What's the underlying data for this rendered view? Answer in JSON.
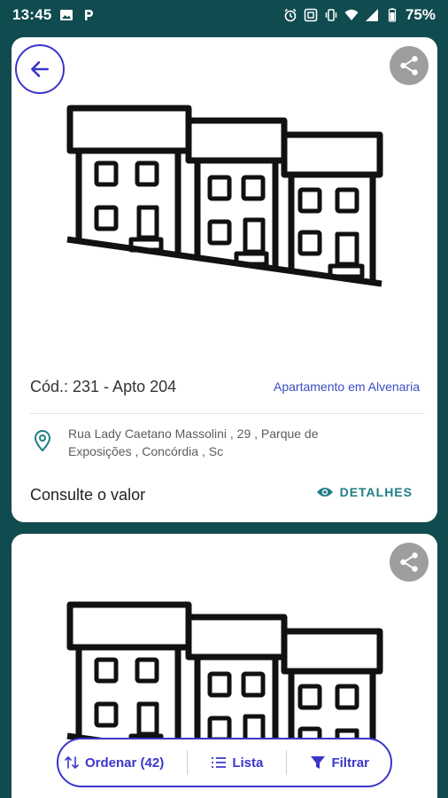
{
  "status_bar": {
    "time": "13:45",
    "battery": "75%",
    "icons": [
      "image-icon",
      "parking-icon",
      "alarm-icon",
      "nfc-icon",
      "vibrate-icon",
      "wifi-icon",
      "signal-icon",
      "battery-icon"
    ]
  },
  "listing": {
    "code": "Cód.: 231 - Apto 204",
    "type": "Apartamento em Alvenaria",
    "address": "Rua Lady Caetano Massolini , 29 , Parque de Exposições  , Concórdia , Sc",
    "price": "Consulte o valor",
    "details_label": "DETALHES"
  },
  "bottom_bar": {
    "sort_label": "Ordenar (42)",
    "list_label": "Lista",
    "filter_label": "Filtrar"
  },
  "colors": {
    "background": "#0f4b4f",
    "accent": "#3b36c9",
    "details": "#1e7d87",
    "share": "#9e9e9e"
  }
}
